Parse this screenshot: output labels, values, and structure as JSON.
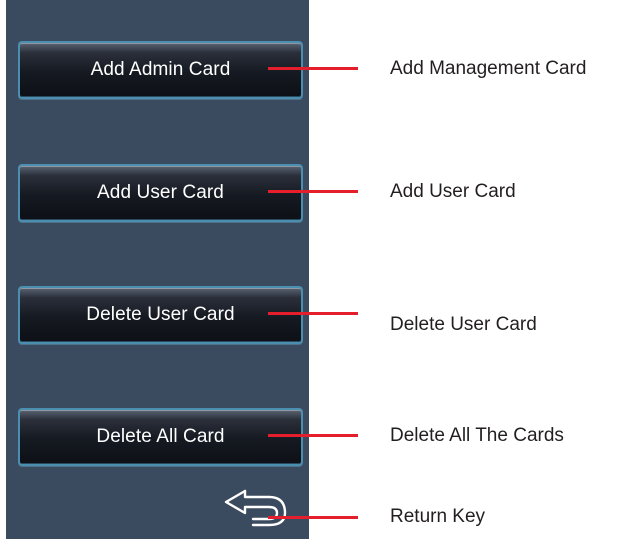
{
  "panel": {
    "background": "#3a4a5f",
    "buttons": [
      {
        "label": "Add Admin Card"
      },
      {
        "label": "Add User Card"
      },
      {
        "label": "Delete User Card"
      },
      {
        "label": "Delete All Card"
      }
    ],
    "back_icon": "return-arrow-icon"
  },
  "callouts": [
    {
      "text": "Add Management Card"
    },
    {
      "text": "Add User Card"
    },
    {
      "text": "Delete User Card"
    },
    {
      "text": "Delete All The Cards"
    },
    {
      "text": "Return Key"
    }
  ],
  "colors": {
    "leader_line": "#e41e2b",
    "button_border": "#4a8fb0",
    "button_text": "#ffffff",
    "callout_text": "#231f20"
  }
}
